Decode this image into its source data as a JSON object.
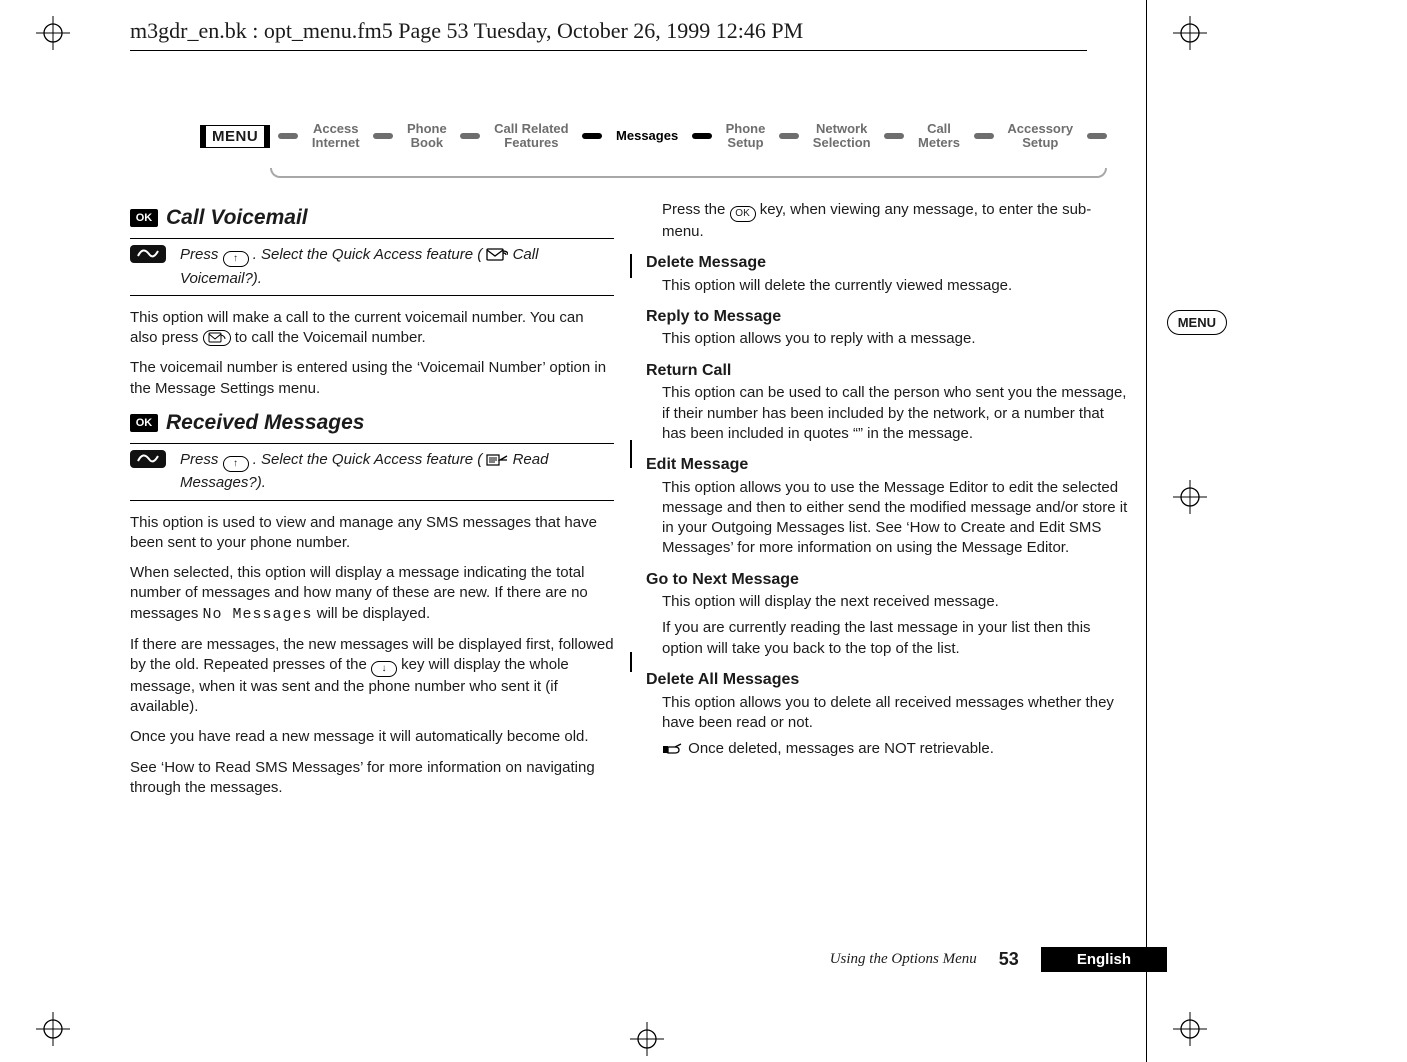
{
  "running_header": "m3gdr_en.bk : opt_menu.fm5  Page 53  Tuesday, October 26, 1999  12:46 PM",
  "ribbon": {
    "menu_label": "MENU",
    "items": [
      {
        "label": "Access\nInternet",
        "active": false
      },
      {
        "label": "Phone\nBook",
        "active": false
      },
      {
        "label": "Call Related\nFeatures",
        "active": false
      },
      {
        "label": "Messages",
        "active": true
      },
      {
        "label": "Phone\nSetup",
        "active": false
      },
      {
        "label": "Network\nSelection",
        "active": false
      },
      {
        "label": "Call\nMeters",
        "active": false
      },
      {
        "label": "Accessory\nSetup",
        "active": false
      }
    ]
  },
  "side_tab": "MENU",
  "left": {
    "section1_title": "Call Voicemail",
    "section1_ok": "OK",
    "qa1_prefix": "Press ",
    "qa1_key": "↑",
    "qa1_mid": ". Select the Quick Access feature (",
    "qa1_feature": " Call Voicemail?).",
    "p1": "This option will make a call to the current voicemail number. You can also press ",
    "p1_tail": " to call the Voicemail number.",
    "p2": "The voicemail number is entered using the ‘Voicemail Number’ option in the Message Settings menu.",
    "section2_title": "Received Messages",
    "section2_ok": "OK",
    "qa2_prefix": "Press ",
    "qa2_key": "↑",
    "qa2_mid": ". Select the Quick Access feature (",
    "qa2_feature": " Read Messages?).",
    "p3": "This option is used to view and manage any SMS messages that have been sent to your phone number.",
    "p4a": "When selected, this option will display a message indicating the total number of messages and how many of these are new. If there are no messages ",
    "p4_lcd": "No Messages",
    "p4b": " will be displayed.",
    "p5a": "If there are messages, the new messages will be displayed first, followed by the old. Repeated presses of the ",
    "p5_key": "↓",
    "p5b": " key will display the whole message, when it was sent and the phone number who sent it (if available).",
    "p6": "Once you have read a new message it will automatically become old.",
    "p7": "See ‘How to Read SMS Messages’ for more information on navigating through the messages."
  },
  "right": {
    "intro_a": "Press the ",
    "intro_key": "OK",
    "intro_b": " key, when viewing any message, to enter the sub-menu.",
    "h_delete": "Delete Message",
    "b_delete": "This option will delete the currently viewed message.",
    "h_reply": "Reply to Message",
    "b_reply": "This option allows you to reply with a message.",
    "h_return": "Return Call",
    "b_return": "This option can be used to call the person who sent you the message, if their number has been included by the network, or a number that has been included in quotes “” in the message.",
    "h_edit": "Edit Message",
    "b_edit": "This option allows you to use the Message Editor to edit the selected message and then to either send the modified message and/or store it in your Outgoing Messages list. See ‘How to Create and Edit SMS Messages’ for more information on using the Message Editor.",
    "h_next": "Go to Next Message",
    "b_next1": "This option will display the next received message.",
    "b_next2": "If you are currently reading the last message in your list then this option will take you back to the top of the list.",
    "h_delall": "Delete All Messages",
    "b_delall": "This option allows you to delete all received messages whether they have been read or not.",
    "note": "Once deleted, messages are NOT retrievable."
  },
  "footer": {
    "chapter": "Using the Options Menu",
    "page": "53",
    "lang": "English"
  }
}
